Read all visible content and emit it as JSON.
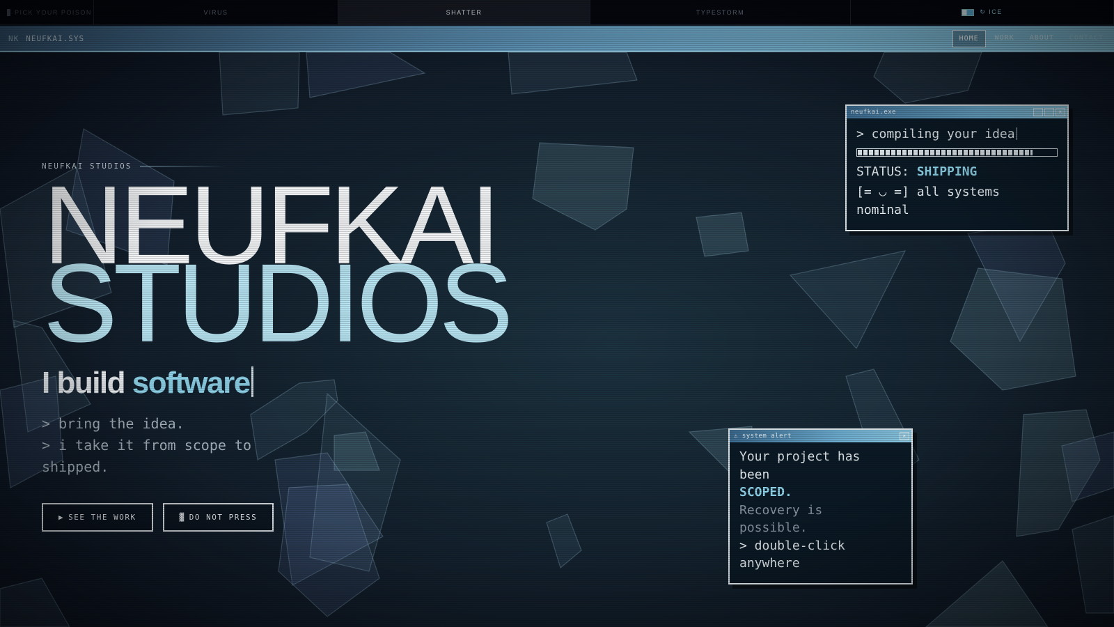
{
  "theme_bar": {
    "pick_label": "PICK YOUR POISON",
    "tabs": [
      {
        "label": "VIRUS"
      },
      {
        "label": "SHATTER",
        "active": true
      },
      {
        "label": "TYPESTORM"
      }
    ],
    "ice_label": "↻ ICE"
  },
  "nav": {
    "logo_mark": "NK",
    "logo_text": "NEUFKAI.SYS",
    "links": [
      "HOME",
      "WORK",
      "ABOUT",
      "CONTACT"
    ],
    "active": "HOME"
  },
  "hero": {
    "eyebrow": "NEUFKAI STUDIOS",
    "title_line1": "NEUFKAI",
    "title_line2": "STUDIOS",
    "tagline_start": "I build ",
    "tagline_accent": "software",
    "lines": [
      "> bring the idea.",
      "> i take it from scope to",
      "shipped."
    ],
    "buttons": {
      "primary_glyph": "▶",
      "primary": "SEE THE WORK",
      "secondary_glyph": "▓",
      "secondary": "DO NOT PRESS"
    }
  },
  "exe_window": {
    "title": "neufkai.exe",
    "line": "> compiling your idea",
    "progress": 0.88,
    "status_label": "STATUS:",
    "status_value": "SHIPPING",
    "nominal_1": "[= ◡ =] all systems",
    "nominal_2": "nominal"
  },
  "alert_window": {
    "title": "⚠ system alert",
    "line1": "Your project has",
    "line2": "been",
    "scoped": "SCOPED.",
    "dim1": "Recovery is",
    "dim2": "possible.",
    "cmd1": "> double-click",
    "cmd2": "anywhere"
  },
  "colors": {
    "accent": "#8fd4ea",
    "nav_gradient_start": "#3b5f80",
    "nav_gradient_end": "#8ccbe4",
    "background": "#14222f"
  }
}
